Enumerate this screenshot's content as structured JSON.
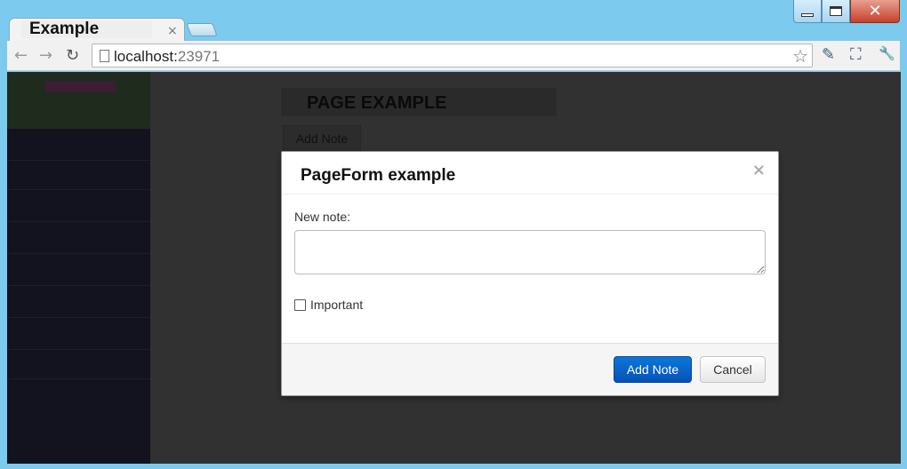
{
  "window": {
    "tab_title": "Example",
    "tab_close": "×",
    "minimize_icon": "minimize-icon",
    "maximize_icon": "maximize-icon",
    "close_glyph": "✕"
  },
  "toolbar": {
    "back_glyph": "←",
    "forward_glyph": "→",
    "reload_glyph": "↻",
    "url_host": "localhost:",
    "url_port": "23971",
    "star_glyph": "☆",
    "eyedropper_glyph": "✎",
    "fullscreen_glyph": "⛶",
    "wrench_glyph": "🔧"
  },
  "page": {
    "title": "PAGE EXAMPLE",
    "add_note_label": "Add Note"
  },
  "modal": {
    "title": "PageForm  example",
    "close_glyph": "×",
    "field_label": "New note:",
    "note_value": "",
    "checkbox_label": "Important",
    "checkbox_checked": false,
    "primary_label": "Add Note",
    "cancel_label": "Cancel"
  },
  "colors": {
    "primary": "#0662c7",
    "overlay": "#313131"
  }
}
